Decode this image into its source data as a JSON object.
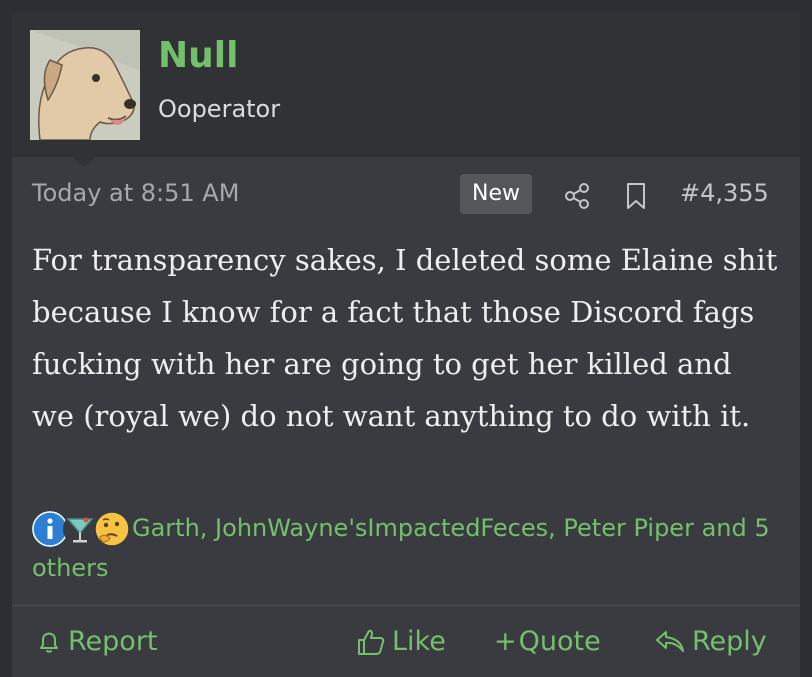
{
  "post": {
    "author": {
      "name": "Null",
      "title": "Ooperator"
    },
    "timestamp": "Today at 8:51 AM",
    "badge": "New",
    "number": "#4,355",
    "body": "For transparency sakes, I deleted some Elaine shit because I know for a fact that those Discord fags fucking with her are going to get her killed and we (royal we) do not want anything to do with it.",
    "reactions": {
      "icons": [
        "info-icon",
        "cocktail-icon",
        "thinking-face-icon"
      ],
      "text": "Garth, JohnWayne'sImpactedFeces, Peter Piper and 5 others"
    },
    "actions": {
      "report": "Report",
      "like": "Like",
      "quote": "Quote",
      "reply": "Reply"
    }
  },
  "colors": {
    "accent": "#74c06a",
    "background": "#2c2e33",
    "card": "#393b40",
    "header": "#303236"
  }
}
